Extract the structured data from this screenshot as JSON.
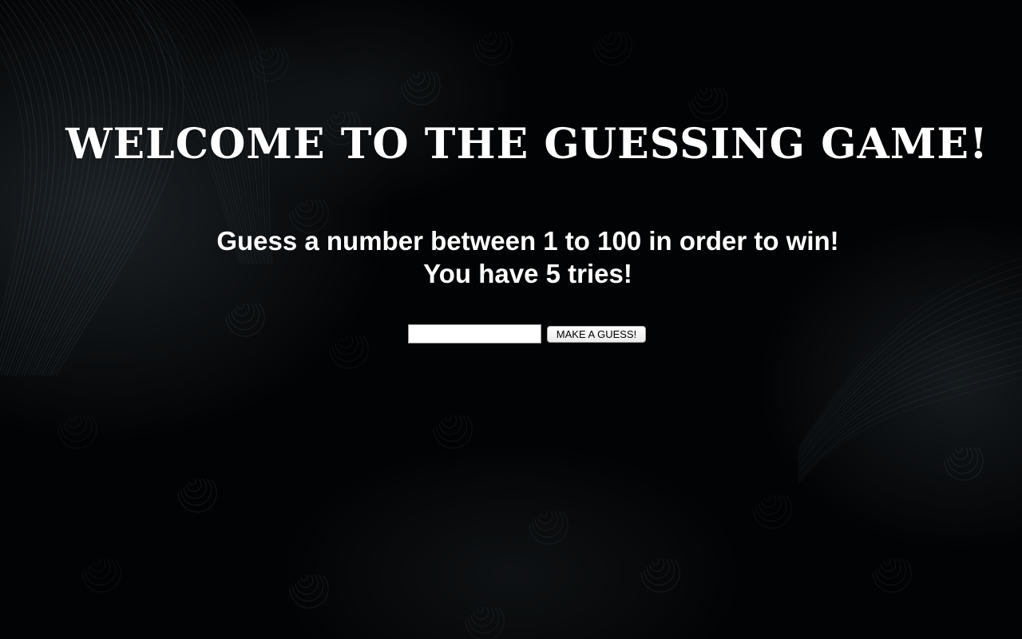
{
  "page": {
    "title": "WELCOME TO THE GUESSING GAME!",
    "instructions": {
      "line1": "Guess a number between 1 to 100 in order to win!",
      "line2": "You have 5 tries!"
    }
  },
  "guess_form": {
    "input_value": "",
    "input_placeholder": "",
    "button_label": "MAKE A GUESS!"
  },
  "colors": {
    "text": "#ffffff",
    "background": "#020304",
    "swirl": "#6f8796"
  }
}
